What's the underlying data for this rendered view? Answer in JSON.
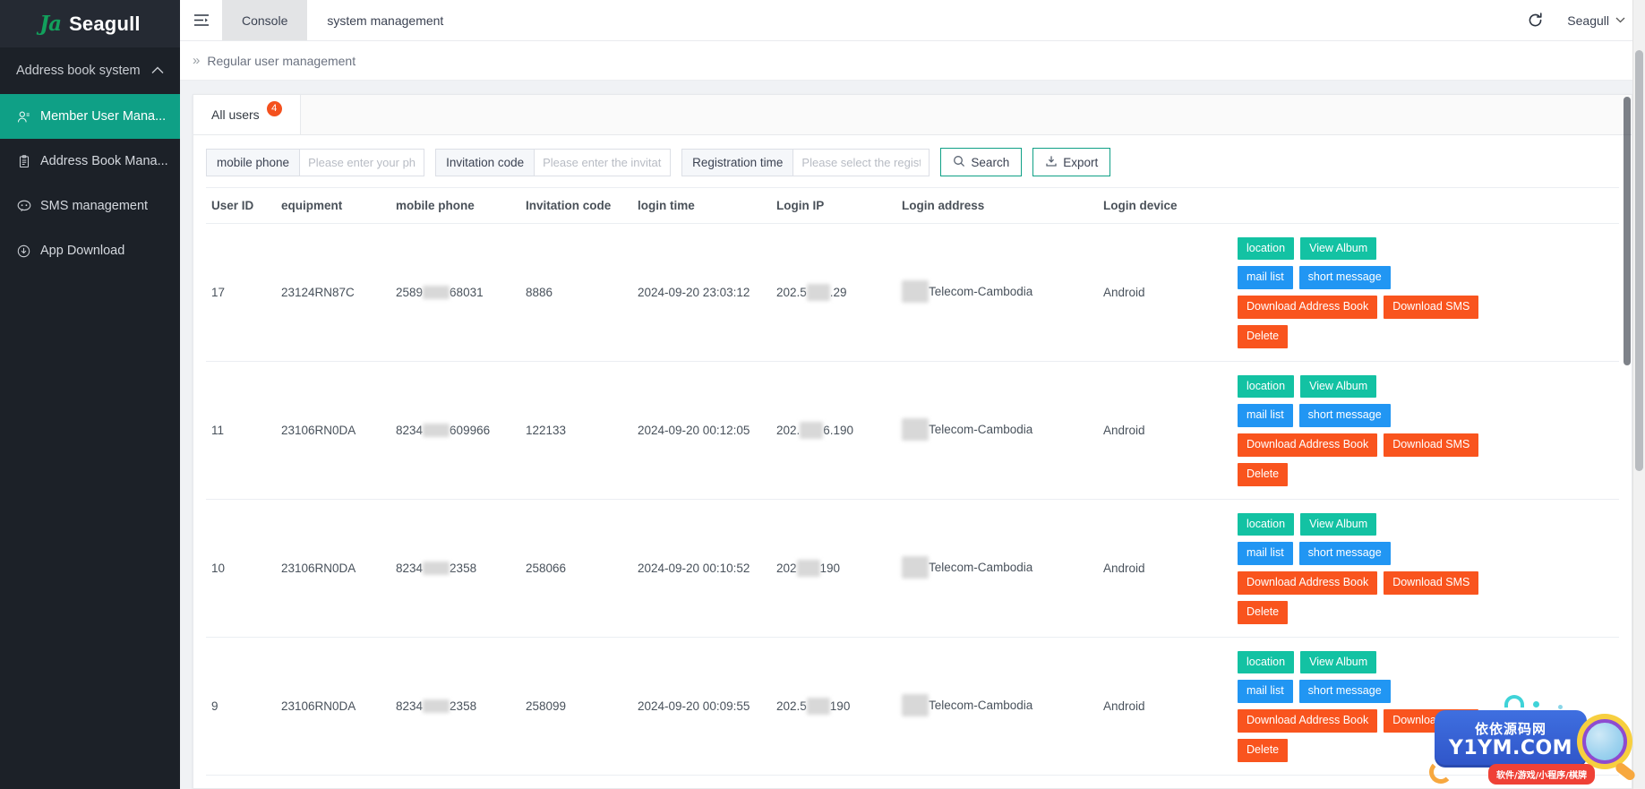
{
  "brand": {
    "mark": "Ja",
    "name": "Seagull"
  },
  "sidebar": {
    "group_label": "Address book system",
    "items": [
      {
        "label": "Member User Mana...",
        "icon": "user-icon",
        "active": true
      },
      {
        "label": "Address Book Mana...",
        "icon": "clipboard-icon",
        "active": false
      },
      {
        "label": "SMS management",
        "icon": "message-icon",
        "active": false
      },
      {
        "label": "App Download",
        "icon": "download-circle-icon",
        "active": false
      }
    ]
  },
  "topbar": {
    "menu_icon": "hamburger-icon",
    "tabs": [
      {
        "label": "Console",
        "selected": true
      },
      {
        "label": "system management",
        "selected": false
      }
    ],
    "refresh_icon": "refresh-icon",
    "user": "Seagull",
    "user_caret": "⌄"
  },
  "breadcrumb": {
    "separator": "»",
    "label": "Regular user management"
  },
  "panel": {
    "tabs": [
      {
        "label": "All users",
        "badge": "4"
      }
    ]
  },
  "filters": {
    "phone": {
      "label": "mobile phone",
      "placeholder": "Please enter your phone",
      "value": ""
    },
    "invite": {
      "label": "Invitation code",
      "placeholder": "Please enter the invitatio",
      "value": ""
    },
    "reg_time": {
      "label": "Registration time",
      "placeholder": "Please select the registr",
      "value": ""
    },
    "search_button": "Search",
    "search_icon": "search-icon",
    "export_button": "Export",
    "export_icon": "export-icon"
  },
  "table": {
    "columns": [
      "User ID",
      "equipment",
      "mobile phone",
      "Invitation code",
      "login time",
      "Login IP",
      "Login address",
      "Login device",
      ""
    ],
    "rows": [
      {
        "user_id": "17",
        "equipment": "23124RN87C",
        "phone_prefix": "2589",
        "phone_suffix": "68031",
        "invitation_code": "8886",
        "login_time": "2024-09-20 23:03:12",
        "ip_prefix": "202.5",
        "ip_suffix": ".29",
        "login_address": "Telecom-Cambodia",
        "login_device": "Android"
      },
      {
        "user_id": "11",
        "equipment": "23106RN0DA",
        "phone_prefix": "8234",
        "phone_suffix": "609966",
        "invitation_code": "122133",
        "login_time": "2024-09-20 00:12:05",
        "ip_prefix": "202.",
        "ip_suffix": "6.190",
        "login_address": "Telecom-Cambodia",
        "login_device": "Android"
      },
      {
        "user_id": "10",
        "equipment": "23106RN0DA",
        "phone_prefix": "8234",
        "phone_suffix": "2358",
        "invitation_code": "258066",
        "login_time": "2024-09-20 00:10:52",
        "ip_prefix": "202",
        "ip_suffix": "190",
        "login_address": "Telecom-Cambodia",
        "login_device": "Android"
      },
      {
        "user_id": "9",
        "equipment": "23106RN0DA",
        "phone_prefix": "8234",
        "phone_suffix": "2358",
        "invitation_code": "258099",
        "login_time": "2024-09-20 00:09:55",
        "ip_prefix": "202.5",
        "ip_suffix": "190",
        "login_address": "Telecom-Cambodia",
        "login_device": "Android"
      }
    ],
    "actions": {
      "location": "location",
      "view_album": "View Album",
      "mail_list": "mail list",
      "short_message": "short message",
      "download_address_book": "Download Address Book",
      "download_sms": "Download SMS",
      "delete": "Delete"
    }
  },
  "watermark": {
    "cn": "依依源码网",
    "en": "Y1YM.COM",
    "ribbon": "软件/游戏/小程序/棋牌"
  },
  "colors": {
    "sidebar_bg": "#1c2128",
    "accent_teal": "#0fa086",
    "button_teal": "#13c2a3",
    "button_blue": "#2196f3",
    "button_red": "#f9541e",
    "badge_orange": "#f4511e"
  }
}
